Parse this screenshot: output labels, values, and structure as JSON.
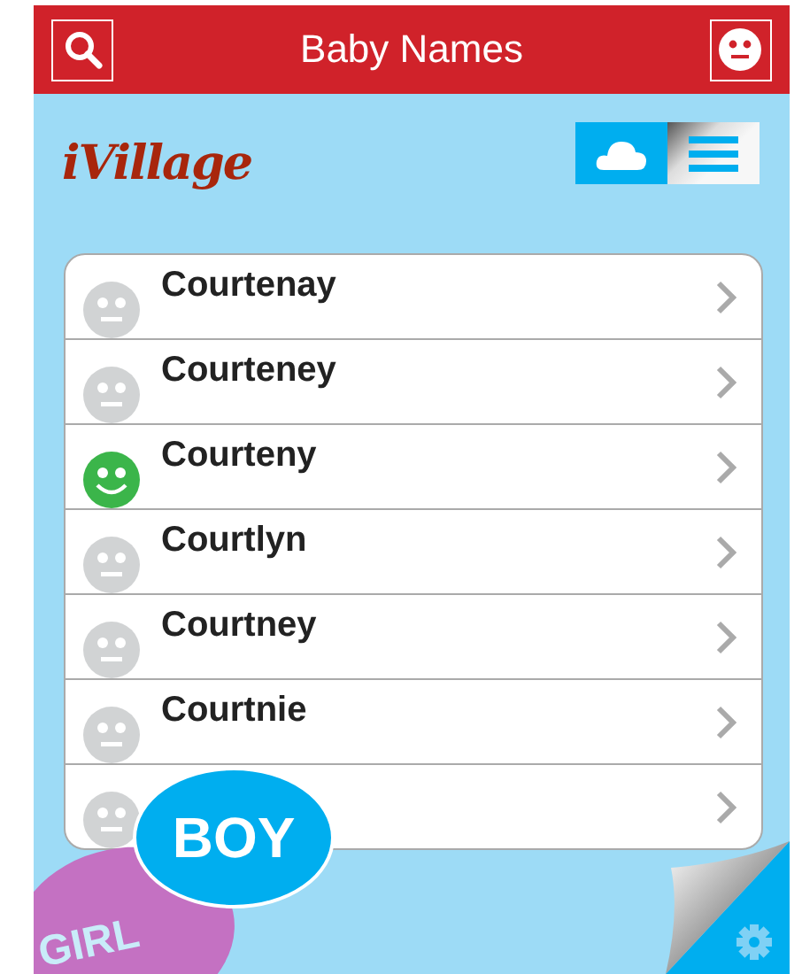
{
  "header": {
    "title": "Baby Names"
  },
  "logo": "iVillage",
  "view_toggle": [
    {
      "kind": "cloud",
      "selected": true
    },
    {
      "kind": "list",
      "selected": false
    }
  ],
  "names": [
    {
      "name": "Courtenay",
      "liked": false
    },
    {
      "name": "Courteney",
      "liked": false
    },
    {
      "name": "Courteny",
      "liked": true
    },
    {
      "name": "Courtlyn",
      "liked": false
    },
    {
      "name": "Courtney",
      "liked": false
    },
    {
      "name": "Courtnie",
      "liked": false
    },
    {
      "liked": false
    }
  ],
  "gender_buttons": [
    {
      "label": "GIRL",
      "kind": "girl"
    },
    {
      "label": "BOY",
      "kind": "boy"
    }
  ]
}
